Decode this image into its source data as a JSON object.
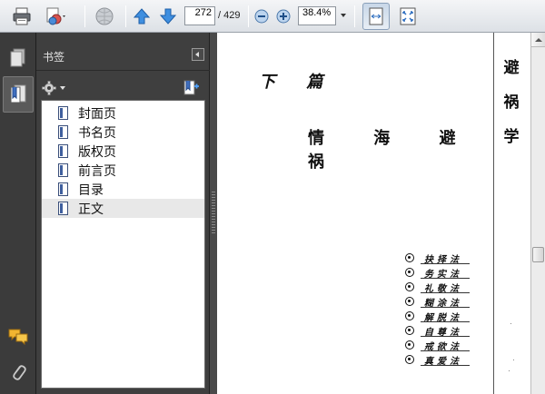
{
  "toolbar": {
    "current_page": "272",
    "page_total": "/ 429",
    "zoom": "38.4%",
    "icons": [
      "printer-icon",
      "page-refresh-icon",
      "globe-icon",
      "arrow-up-icon",
      "arrow-down-icon",
      "zoom-out-icon",
      "zoom-in-icon",
      "fit-width-icon",
      "full-screen-icon"
    ]
  },
  "bookmarks_panel": {
    "title": "书签",
    "items": [
      {
        "label": "封面页"
      },
      {
        "label": "书名页"
      },
      {
        "label": "版权页"
      },
      {
        "label": "前言页"
      },
      {
        "label": "目录"
      },
      {
        "label": "正文",
        "selected": true
      }
    ]
  },
  "document": {
    "heading_part": "下 篇",
    "heading_title": "情 海 避 祸",
    "side_title": "避祸学",
    "methods": [
      "抉择法",
      "务实法",
      "礼敬法",
      "糊涂法",
      "解脱法",
      "自尊法",
      "戒欲法",
      "真爱法"
    ]
  },
  "colors": {
    "toolbar_bg": "#e6e9ed",
    "panel_bg": "#3f3f3f",
    "rail_bg": "#3b3b3b",
    "selected_row": "#e8e8e8",
    "accent_blue": "#2f7ad8"
  }
}
